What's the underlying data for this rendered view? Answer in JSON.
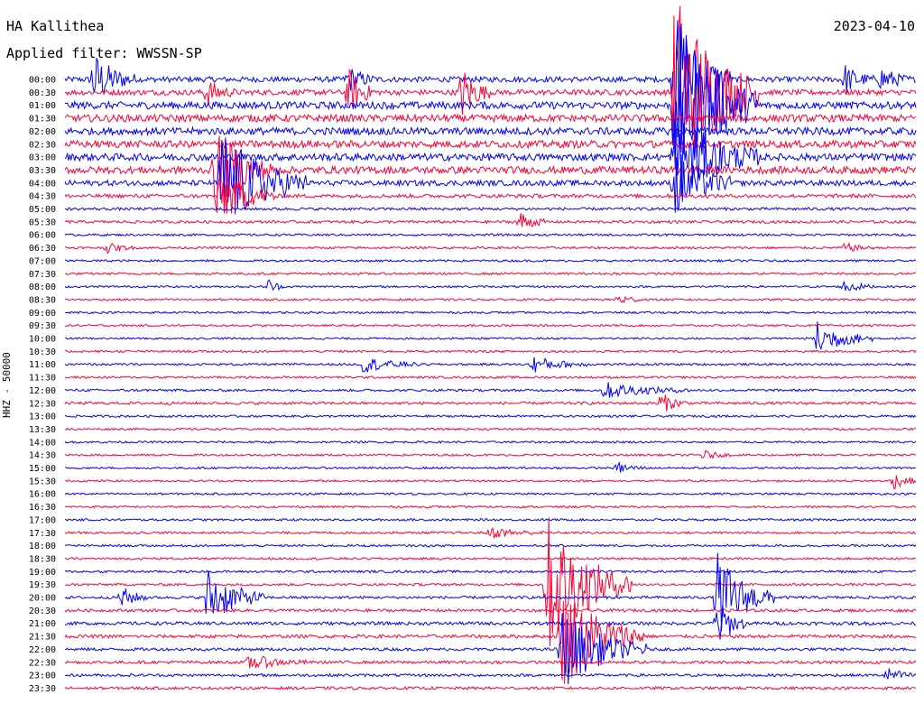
{
  "header": {
    "station": "HA Kallithea",
    "filter": "Applied filter: WWSSN-SP",
    "date": "2023-04-10",
    "channel_label": "HHZ - 50000"
  },
  "colors": {
    "blue": "#0000ff",
    "red": "#ff0033"
  },
  "chart_data": {
    "type": "line",
    "title": "HA Kallithea",
    "subtitle": "Applied filter: WWSSN-SP",
    "ylabel": "HHZ - 50000",
    "row_labels": [
      "00:00",
      "00:30",
      "01:00",
      "01:30",
      "02:00",
      "02:30",
      "03:00",
      "03:30",
      "04:00",
      "04:30",
      "05:00",
      "05:30",
      "06:00",
      "06:30",
      "07:00",
      "07:30",
      "08:00",
      "08:30",
      "09:00",
      "09:30",
      "10:00",
      "10:30",
      "11:00",
      "11:30",
      "12:00",
      "12:30",
      "13:00",
      "13:30",
      "14:00",
      "14:30",
      "15:00",
      "15:30",
      "16:00",
      "16:30",
      "17:00",
      "17:30",
      "18:00",
      "18:30",
      "19:00",
      "19:30",
      "20:00",
      "20:30",
      "21:00",
      "21:30",
      "22:00",
      "22:30",
      "23:00",
      "23:30"
    ],
    "row_colors": [
      "blue",
      "red"
    ],
    "noise_levels": [
      3,
      3,
      4,
      4,
      4,
      4,
      4,
      4,
      3,
      2,
      1.5,
      1.5,
      1.2,
      1.2,
      1.2,
      1.2,
      1.1,
      1.1,
      1.1,
      1.1,
      1.1,
      1.2,
      1.2,
      1.2,
      1.3,
      1.5,
      1.2,
      1.1,
      1.1,
      1.1,
      1.1,
      1.1,
      1.1,
      1.1,
      1.2,
      1.2,
      1.2,
      1.2,
      1.3,
      1.3,
      1.5,
      1.6,
      1.8,
      1.8,
      1.6,
      1.6,
      1.5,
      1.5
    ],
    "events": [
      {
        "row": 0,
        "minute": 1,
        "amplitude": 30,
        "duration": 1.5
      },
      {
        "row": 0,
        "minute": 10,
        "amplitude": 14,
        "duration": 1
      },
      {
        "row": 0,
        "minute": 21.5,
        "amplitude": 80,
        "duration": 2
      },
      {
        "row": 0,
        "minute": 27.5,
        "amplitude": 16,
        "duration": 1
      },
      {
        "row": 0,
        "minute": 28.8,
        "amplitude": 14,
        "duration": 1
      },
      {
        "row": 1,
        "minute": 5,
        "amplitude": 14,
        "duration": 1
      },
      {
        "row": 1,
        "minute": 10,
        "amplitude": 25,
        "duration": 1
      },
      {
        "row": 1,
        "minute": 14,
        "amplitude": 30,
        "duration": 1
      },
      {
        "row": 1,
        "minute": 21.5,
        "amplitude": 120,
        "duration": 3
      },
      {
        "row": 2,
        "minute": 21.5,
        "amplitude": 100,
        "duration": 3
      },
      {
        "row": 6,
        "minute": 21.5,
        "amplitude": 50,
        "duration": 3
      },
      {
        "row": 7,
        "minute": 5.3,
        "amplitude": 50,
        "duration": 2
      },
      {
        "row": 8,
        "minute": 5.5,
        "amplitude": 60,
        "duration": 3
      },
      {
        "row": 8,
        "minute": 21.5,
        "amplitude": 40,
        "duration": 2
      },
      {
        "row": 9,
        "minute": 5.5,
        "amplitude": 30,
        "duration": 2
      },
      {
        "row": 11,
        "minute": 16,
        "amplitude": 12,
        "duration": 1
      },
      {
        "row": 13,
        "minute": 1.5,
        "amplitude": 5,
        "duration": 1
      },
      {
        "row": 13,
        "minute": 27.5,
        "amplitude": 5,
        "duration": 1
      },
      {
        "row": 16,
        "minute": 7.2,
        "amplitude": 10,
        "duration": 0.5
      },
      {
        "row": 16,
        "minute": 27.5,
        "amplitude": 8,
        "duration": 1
      },
      {
        "row": 17,
        "minute": 19.5,
        "amplitude": 6,
        "duration": 1
      },
      {
        "row": 20,
        "minute": 26.5,
        "amplitude": 20,
        "duration": 2
      },
      {
        "row": 22,
        "minute": 10.5,
        "amplitude": 9,
        "duration": 2
      },
      {
        "row": 22,
        "minute": 16.5,
        "amplitude": 9,
        "duration": 2
      },
      {
        "row": 24,
        "minute": 19,
        "amplitude": 9,
        "duration": 3
      },
      {
        "row": 25,
        "minute": 21,
        "amplitude": 12,
        "duration": 1
      },
      {
        "row": 29,
        "minute": 22.5,
        "amplitude": 5,
        "duration": 1
      },
      {
        "row": 30,
        "minute": 19.5,
        "amplitude": 6,
        "duration": 1
      },
      {
        "row": 31,
        "minute": 29.2,
        "amplitude": 9,
        "duration": 1
      },
      {
        "row": 35,
        "minute": 15,
        "amplitude": 6,
        "duration": 2
      },
      {
        "row": 39,
        "minute": 17,
        "amplitude": 80,
        "duration": 3
      },
      {
        "row": 40,
        "minute": 2.0,
        "amplitude": 12,
        "duration": 1
      },
      {
        "row": 40,
        "minute": 23,
        "amplitude": 50,
        "duration": 2
      },
      {
        "row": 40,
        "minute": 5.0,
        "amplitude": 35,
        "duration": 2
      },
      {
        "row": 42,
        "minute": 23,
        "amplitude": 30,
        "duration": 1
      },
      {
        "row": 43,
        "minute": 17.5,
        "amplitude": 60,
        "duration": 3
      },
      {
        "row": 44,
        "minute": 17.5,
        "amplitude": 45,
        "duration": 3
      },
      {
        "row": 45,
        "minute": 6.5,
        "amplitude": 8,
        "duration": 2
      },
      {
        "row": 46,
        "minute": 29,
        "amplitude": 8,
        "duration": 1
      }
    ]
  }
}
